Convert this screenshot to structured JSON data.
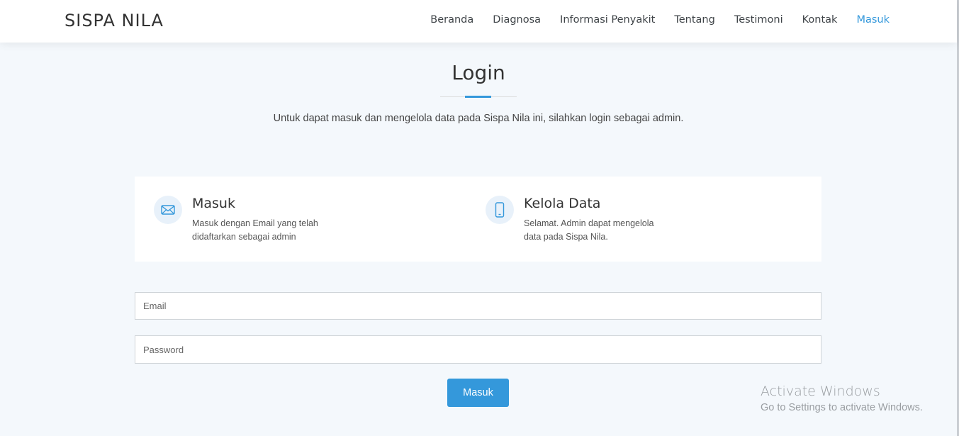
{
  "header": {
    "brand": "SISPA NILA",
    "nav": [
      "Beranda",
      "Diagnosa",
      "Informasi Penyakit",
      "Tentang",
      "Testimoni",
      "Kontak",
      "Masuk"
    ],
    "active_color": "#3498db"
  },
  "section": {
    "title": "Login",
    "subtitle": "Untuk dapat masuk dan mengelola data pada Sispa Nila ini, silahkan login sebagai admin."
  },
  "info": [
    {
      "icon": "envelope-icon",
      "title": "Masuk",
      "text": "Masuk dengan Email yang telah didaftarkan sebagai admin"
    },
    {
      "icon": "phone-icon",
      "title": "Kelola Data",
      "text": "Selamat. Admin dapat mengelola data pada Sispa Nila."
    }
  ],
  "form": {
    "email_placeholder": "Email",
    "email_value": "",
    "password_placeholder": "Password",
    "password_value": "",
    "submit_label": "Masuk",
    "accent": "#3498db"
  },
  "watermark": {
    "line1": "Activate Windows",
    "line2": "Go to Settings to activate Windows."
  }
}
